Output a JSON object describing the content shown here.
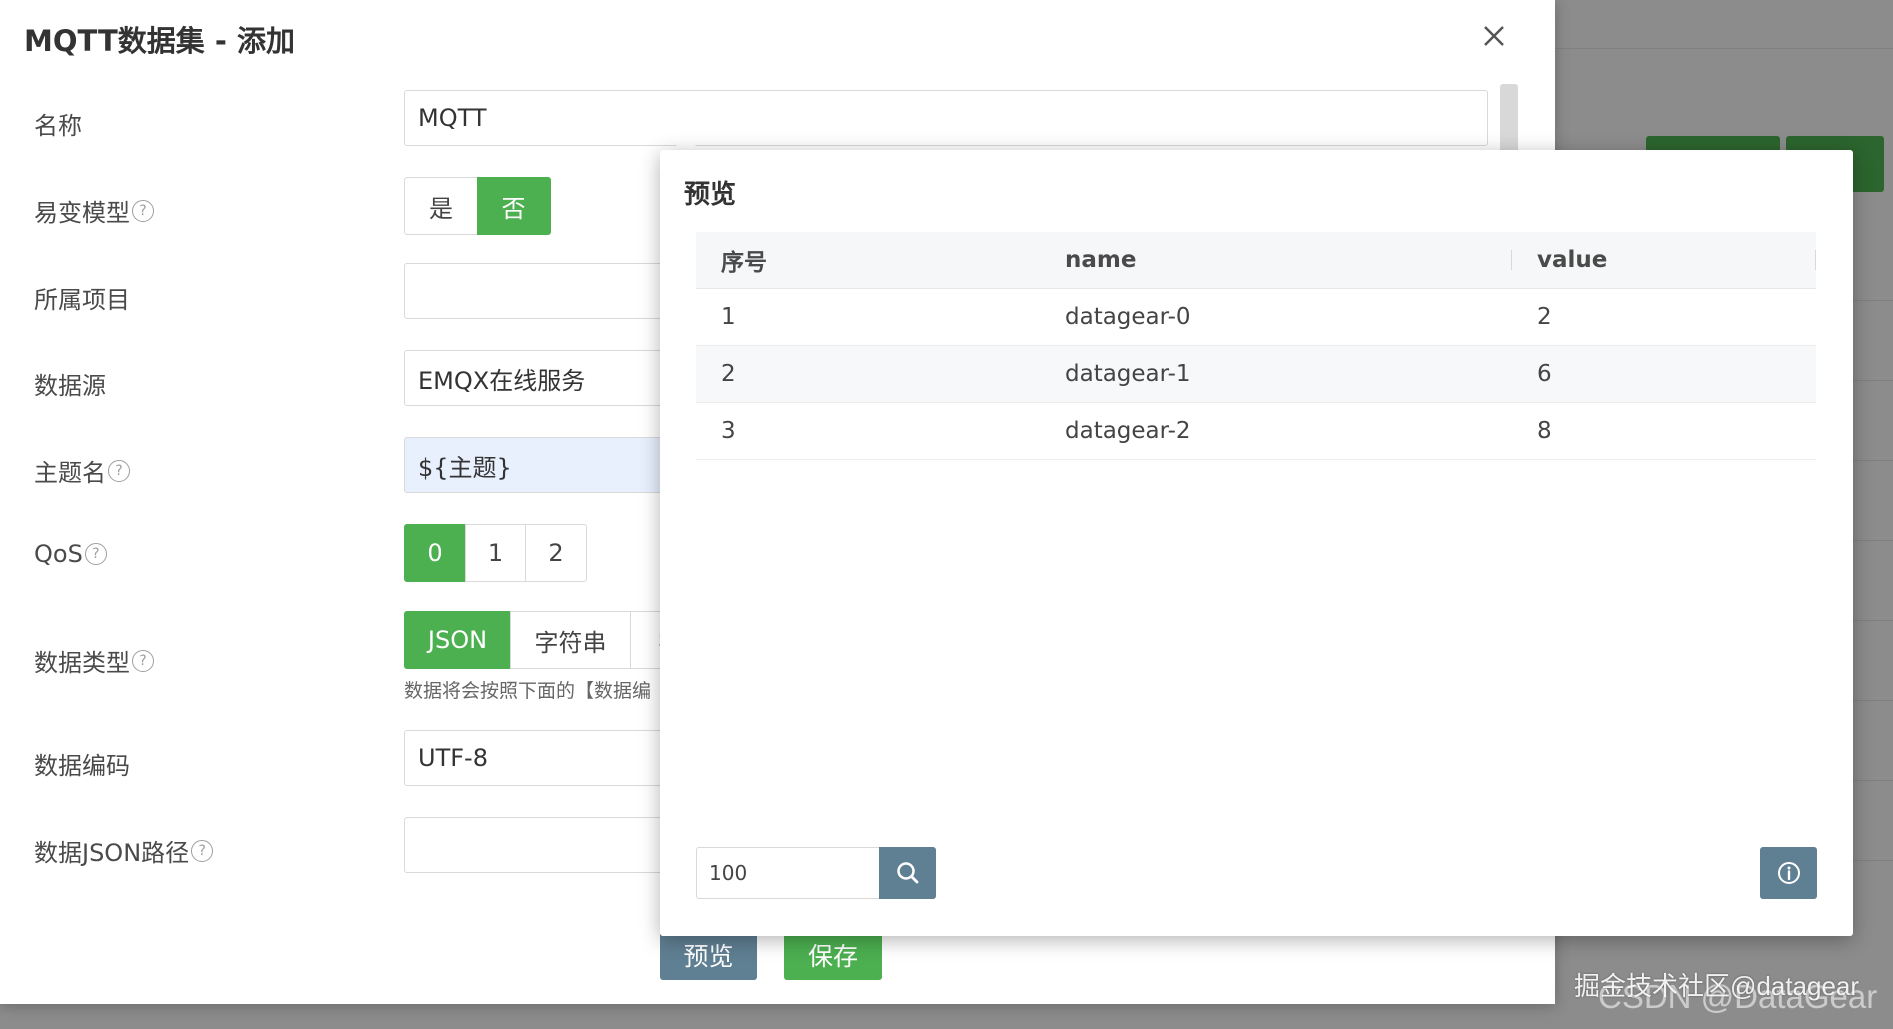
{
  "dialog": {
    "title": "MQTT数据集 - 添加",
    "close_label": "×"
  },
  "form": {
    "name": {
      "label": "名称",
      "value": "MQTT"
    },
    "mutable_model": {
      "label": "易变模型",
      "help": "?",
      "options": [
        "是",
        "否"
      ],
      "selected": "否"
    },
    "project": {
      "label": "所属项目",
      "value": ""
    },
    "data_source": {
      "label": "数据源",
      "value": "EMQX在线服务"
    },
    "topic": {
      "label": "主题名",
      "help": "?",
      "value": "${主题}"
    },
    "qos": {
      "label": "QoS",
      "help": "?",
      "options": [
        "0",
        "1",
        "2"
      ],
      "selected": "0"
    },
    "data_type": {
      "label": "数据类型",
      "help": "?",
      "options": [
        "JSON",
        "字符串",
        "字"
      ],
      "selected": "JSON",
      "hint": "数据将会按照下面的【数据编"
    },
    "encoding": {
      "label": "数据编码",
      "value": "UTF-8"
    },
    "json_path": {
      "label": "数据JSON路径",
      "help": "?",
      "value": ""
    }
  },
  "footer": {
    "preview_label": "预览",
    "save_label": "保存"
  },
  "preview": {
    "title": "预览",
    "columns": [
      "序号",
      "name",
      "value"
    ],
    "rows": [
      [
        "1",
        "datagear-0",
        "2"
      ],
      [
        "2",
        "datagear-1",
        "6"
      ],
      [
        "3",
        "datagear-2",
        "8"
      ]
    ],
    "count_value": "100"
  },
  "watermark": "掘金技术社区@datagear",
  "watermark_bg": "CSDN @DataGear",
  "colors": {
    "accent_green": "#4caf50",
    "slate_button": "#5f7f92",
    "topic_field_bg": "#e8f0fe"
  }
}
